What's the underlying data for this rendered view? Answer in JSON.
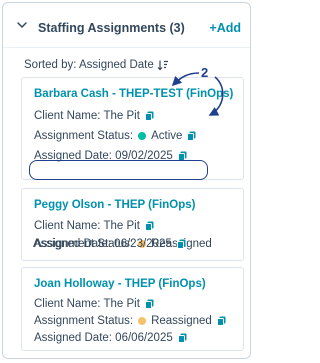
{
  "panel": {
    "title": "Staffing Assignments (3)",
    "add_label": "+Add",
    "sort_label": "Sorted by: Assigned Date",
    "sort_icon": "sort-descending-icon"
  },
  "annotation": {
    "callout_number": "2",
    "color": "#1f3f8f"
  },
  "colors": {
    "link": "#0091ae",
    "active": "#00bda5",
    "reassigned": "#f5c26b",
    "text": "#33475b"
  },
  "cards": [
    {
      "title": "Barbara Cash - THEP-TEST (FinOps)",
      "client_label": "Client Name: The Pit",
      "status_label": "Assignment Status:",
      "status_value": "Active",
      "status_color": "#00bda5",
      "date_label": "Assigned Date: 09/02/2025"
    },
    {
      "title": "Peggy Olson - THEP (FinOps)",
      "client_label": "Client Name: The Pit",
      "status_label": "Assignment Status:",
      "status_value": "Reassigned",
      "status_color": "#f5c26b",
      "date_label": "Assigned Date: 06/23/2025"
    },
    {
      "title": "Joan Holloway - THEP (FinOps)",
      "client_label": "Client Name: The Pit",
      "status_label": "Assignment Status:",
      "status_value": "Reassigned",
      "status_color": "#f5c26b",
      "date_label": "Assigned Date: 06/06/2025"
    }
  ]
}
